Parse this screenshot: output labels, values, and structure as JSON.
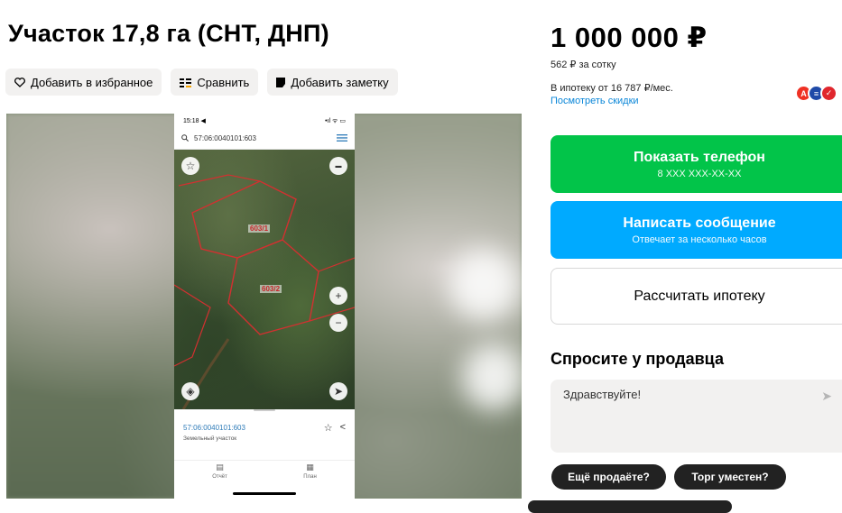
{
  "listing": {
    "title": "Участок 17,8 га (СНТ, ДНП)",
    "price": "1 000 000 ₽",
    "price_per_sotka": "562 ₽ за сотку",
    "mortgage_text": "В ипотеку от 16 787 ₽/мес.",
    "discounts_link": "Посмотреть скидки"
  },
  "actions": {
    "favorite_label": "Добавить в избранное",
    "compare_label": "Сравнить",
    "note_label": "Добавить заметку"
  },
  "buttons": {
    "phone_main": "Показать телефон",
    "phone_sub": "8 XXX XXX-XX-XX",
    "message_main": "Написать сообщение",
    "message_sub": "Отвечает за несколько часов",
    "mortgage_calc": "Рассчитать ипотеку"
  },
  "ask": {
    "title": "Спросите у продавца",
    "message": "Здравствуйте!",
    "chips": [
      "Ещё продаёте?",
      "Торг уместен?"
    ]
  },
  "banks": [
    {
      "letter": "А",
      "color": "#ef3124"
    },
    {
      "letter": "≡",
      "color": "#1f4aa8"
    },
    {
      "letter": "✓",
      "color": "#e0262d"
    }
  ],
  "photo": {
    "status_time": "15:18 ◀",
    "cadastral_query": "57:06:0040101:603",
    "parcel_1": "603/1",
    "parcel_2": "603/2",
    "card_number": "57:06:0040101:603",
    "card_type": "Земельный участок",
    "tab_report": "Отчёт",
    "tab_plan": "План"
  },
  "icons": {
    "favorite": "heart-icon",
    "compare": "compare-icon",
    "note": "note-icon",
    "send": "send-icon"
  }
}
